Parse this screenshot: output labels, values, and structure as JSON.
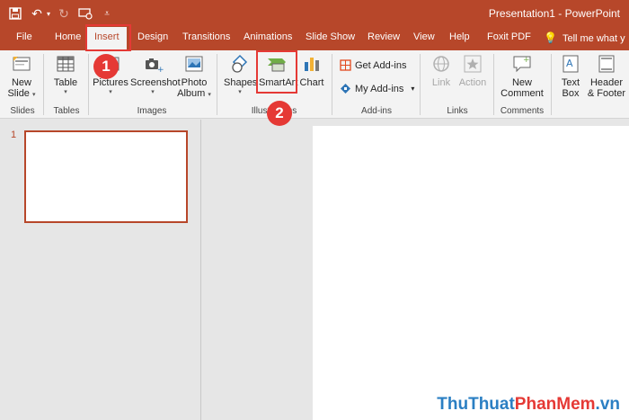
{
  "window": {
    "title": "Presentation1  -  PowerPoint",
    "qat": {
      "save_icon": "save-icon",
      "undo_icon": "undo-icon",
      "redo_icon": "redo-icon",
      "present_icon": "present-icon",
      "customize_icon": "customize-icon"
    }
  },
  "tabs": [
    "File",
    "Home",
    "Insert",
    "Design",
    "Transitions",
    "Animations",
    "Slide Show",
    "Review",
    "View",
    "Help",
    "Foxit PDF"
  ],
  "active_tab": "Insert",
  "tell_me": "Tell me what y",
  "ribbon": {
    "new_slide": {
      "line1": "New",
      "line2": "Slide"
    },
    "table": "Table",
    "pictures": "Pictures",
    "screenshot": "Screenshot",
    "photo_album": {
      "line1": "Photo",
      "line2": "Album"
    },
    "shapes": "Shapes",
    "smartart": "SmartArt",
    "chart": "Chart",
    "get_addins": "Get Add-ins",
    "my_addins": "My Add-ins",
    "link": "Link",
    "action": "Action",
    "new_comment": {
      "line1": "New",
      "line2": "Comment"
    },
    "text_box": {
      "line1": "Text",
      "line2": "Box"
    },
    "header_footer": {
      "line1": "Header",
      "line2": "& Footer"
    },
    "groups": {
      "slides": "Slides",
      "tables": "Tables",
      "images": "Images",
      "illustrations": "Illustrations",
      "addins": "Add-ins",
      "links": "Links",
      "comments": "Comments"
    }
  },
  "thumbnails": [
    {
      "number": "1"
    }
  ],
  "annotations": {
    "step1": "1",
    "step2": "2"
  },
  "watermark": {
    "part1": "ThuThuat",
    "part2": "PhanMem",
    "part3": ".vn"
  },
  "colors": {
    "accent": "#b7472a",
    "callout": "#e53935"
  }
}
